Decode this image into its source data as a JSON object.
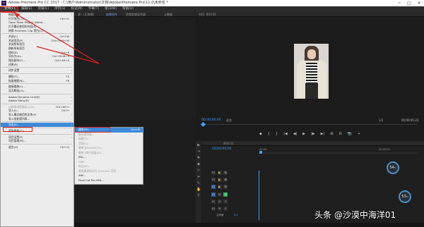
{
  "window": {
    "title": "Adobe Premiere Pro CC 2017 - C:\\用户\\Administrator\\文档\\Adobe\\Premiere Pro\\11.0\\未命名 *",
    "controls": [
      "─",
      "□",
      "✕"
    ]
  },
  "menubar": {
    "items": [
      "文件(F)",
      "编辑(E)",
      "剪辑(C)",
      "序列(S)",
      "标记(M)",
      "字幕(T)",
      "窗口(W)",
      "帮助(H)"
    ]
  },
  "source_panel": {
    "tab1": "源：(无剪辑)",
    "tab2": "效果控件",
    "tab3": "音频剪辑混合器",
    "tab4": "元数据"
  },
  "program_panel": {
    "tab": "节目: 序列 01",
    "timecode_left": "00;00;00;00",
    "fit_label": "适合",
    "quality": "1/2",
    "timecode_right": "00;00;05;23"
  },
  "playback_controls": [
    "◆",
    "{",
    "}",
    "|◀",
    "◀|",
    "▶",
    "|▶",
    "▶|",
    "⊞",
    "⊟",
    "📷",
    "+"
  ],
  "timeline": {
    "tab": "序列 01",
    "timecode": "00;00;00;00",
    "ruler_start": ":00;00",
    "ruler_end": "00;00;04",
    "tracks": [
      {
        "name": "V3",
        "type": "video"
      },
      {
        "name": "V2",
        "type": "video"
      },
      {
        "name": "V1",
        "type": "video"
      },
      {
        "name": "A1",
        "type": "audio"
      },
      {
        "name": "A2",
        "type": "audio"
      },
      {
        "name": "A3",
        "type": "audio"
      }
    ],
    "master_label": "主声道",
    "master_value": "0.0"
  },
  "tools": [
    "▶",
    "⇥",
    "✥",
    "◆",
    "✂",
    "⇹",
    "✎",
    "✋",
    "T"
  ],
  "file_menu": {
    "items": [
      {
        "label": "新建(N)",
        "shortcut": "",
        "arrow": true,
        "disabled": false
      },
      {
        "label": "打开项目(O)...",
        "shortcut": "Ctrl+O",
        "arrow": false,
        "disabled": false
      },
      {
        "label": "Open Team Project (Beta)...",
        "shortcut": "",
        "arrow": false,
        "disabled": false
      },
      {
        "label": "打开最近使用的内容(E)",
        "shortcut": "",
        "arrow": true,
        "disabled": false
      },
      {
        "label": "转换 Premiere Clip 项目(C)...",
        "shortcut": "",
        "arrow": false,
        "disabled": false
      },
      {
        "sep": true
      },
      {
        "label": "关闭(C)",
        "shortcut": "Ctrl+W",
        "arrow": false,
        "disabled": false
      },
      {
        "label": "关闭项目(P)",
        "shortcut": "Ctrl+Shift+W",
        "arrow": false,
        "disabled": false
      },
      {
        "label": "关闭所有项目",
        "shortcut": "",
        "arrow": false,
        "disabled": false
      },
      {
        "label": "刷新所有项目",
        "shortcut": "",
        "arrow": false,
        "disabled": false
      },
      {
        "label": "保存(S)",
        "shortcut": "Ctrl+S",
        "arrow": false,
        "disabled": false
      },
      {
        "label": "另存为(A)...",
        "shortcut": "Ctrl+Shift+S",
        "arrow": false,
        "disabled": false
      },
      {
        "label": "保存副本(Y)...",
        "shortcut": "Ctrl+Alt+S",
        "arrow": false,
        "disabled": false
      },
      {
        "label": "还原(R)",
        "shortcut": "",
        "arrow": false,
        "disabled": false
      },
      {
        "sep": true
      },
      {
        "label": "同步设置",
        "shortcut": "",
        "arrow": true,
        "disabled": false
      },
      {
        "sep": true
      },
      {
        "label": "捕捉(T)...",
        "shortcut": "F5",
        "arrow": false,
        "disabled": false
      },
      {
        "label": "批量捕捉(B)...",
        "shortcut": "F6",
        "arrow": false,
        "disabled": false
      },
      {
        "sep": true
      },
      {
        "label": "链接媒体(L)...",
        "shortcut": "",
        "arrow": false,
        "disabled": false
      },
      {
        "label": "设为脱机(O)...",
        "shortcut": "",
        "arrow": false,
        "disabled": false
      },
      {
        "sep": true
      },
      {
        "label": "Adobe Dynamic Link(K)",
        "shortcut": "",
        "arrow": true,
        "disabled": false
      },
      {
        "label": "Adobe Story(R)",
        "shortcut": "",
        "arrow": true,
        "disabled": false
      },
      {
        "sep": true
      },
      {
        "label": "从媒体浏览器导入(M)",
        "shortcut": "Ctrl+Alt+I",
        "arrow": false,
        "disabled": true
      },
      {
        "label": "导入(I)...",
        "shortcut": "Ctrl+I",
        "arrow": false,
        "disabled": false
      },
      {
        "label": "导入最近使用的文件(F)",
        "shortcut": "",
        "arrow": true,
        "disabled": false
      },
      {
        "label": "导入批处理列表...",
        "shortcut": "",
        "arrow": false,
        "disabled": false
      },
      {
        "sep": true
      },
      {
        "label": "导出(E)",
        "shortcut": "",
        "arrow": true,
        "disabled": false,
        "highlight": true
      },
      {
        "sep": true
      },
      {
        "label": "获取属性(G)",
        "shortcut": "",
        "arrow": true,
        "disabled": false
      },
      {
        "sep": true
      },
      {
        "label": "项目设置(P)",
        "shortcut": "",
        "arrow": true,
        "disabled": false
      },
      {
        "label": "项目管理(M)...",
        "shortcut": "",
        "arrow": false,
        "disabled": false
      },
      {
        "sep": true
      },
      {
        "label": "退出(X)",
        "shortcut": "Ctrl+Q",
        "arrow": false,
        "disabled": false
      }
    ]
  },
  "export_menu": {
    "items": [
      {
        "label": "媒体(M)...",
        "shortcut": "Ctrl+M",
        "disabled": false,
        "highlight": true
      },
      {
        "label": "批处理列表...",
        "shortcut": "",
        "disabled": true
      },
      {
        "label": "标题(T)...",
        "shortcut": "",
        "disabled": true
      },
      {
        "label": "字幕(C)...",
        "shortcut": "",
        "disabled": true
      },
      {
        "label": "磁带 (DV/HDV)(T)...",
        "shortcut": "",
        "disabled": true
      },
      {
        "label": "磁带 (串行设备)(S)...",
        "shortcut": "",
        "disabled": true
      },
      {
        "label": "EDL...",
        "shortcut": "",
        "disabled": false
      },
      {
        "label": "OMF...",
        "shortcut": "",
        "disabled": true
      },
      {
        "label": "标记(M)...",
        "shortcut": "",
        "disabled": true
      },
      {
        "label": "将选择项导出为 Premiere 项目...",
        "shortcut": "",
        "disabled": true
      },
      {
        "label": "AAF...",
        "shortcut": "",
        "disabled": false
      },
      {
        "label": "Final Cut Pro XML...",
        "shortcut": "",
        "disabled": false
      }
    ]
  },
  "gauges": [
    {
      "value": "54",
      "unit": "%"
    },
    {
      "value": "53",
      "unit": "%"
    }
  ],
  "watermark": "头条 @沙漠中海洋01",
  "colors": {
    "accent": "#3c8ad8",
    "highlight_box": "#e02020",
    "timecode": "#3aa0ff",
    "clip_green": "#2fb05b"
  }
}
